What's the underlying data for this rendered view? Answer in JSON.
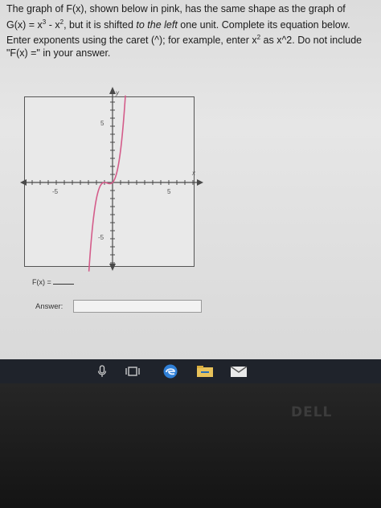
{
  "question": {
    "s1": "The graph of F(x), shown below in pink, has the same shape as the graph of",
    "s2a": "G(x) = x",
    "s2b": "3",
    "s2c": " - x",
    "s2d": "2",
    "s2e": ", but it is shifted ",
    "s2f": "to the left",
    "s2g": " one unit. Complete its equation below.",
    "s3a": "Enter exponents using the caret (^); for example, enter x",
    "s3b": "2",
    "s3c": " as x^2. Do not include",
    "s4": "\"F(x) =\" in your answer."
  },
  "graph": {
    "y_label": "y",
    "x_label": "x",
    "tick_x_neg": "-5",
    "tick_x_pos": "5",
    "tick_y_pos": "5",
    "tick_y_neg": "-5",
    "curve_color": "#d45c8a",
    "axis_color": "#4a4a4a"
  },
  "fx_label": "F(x) =",
  "answer": {
    "label": "Answer:",
    "value": ""
  },
  "taskbar": {
    "icons": [
      "microphone-icon",
      "task-view-icon",
      "edge-browser-icon",
      "file-explorer-icon",
      "mail-icon"
    ]
  },
  "monitor": {
    "brand": "DELL"
  }
}
